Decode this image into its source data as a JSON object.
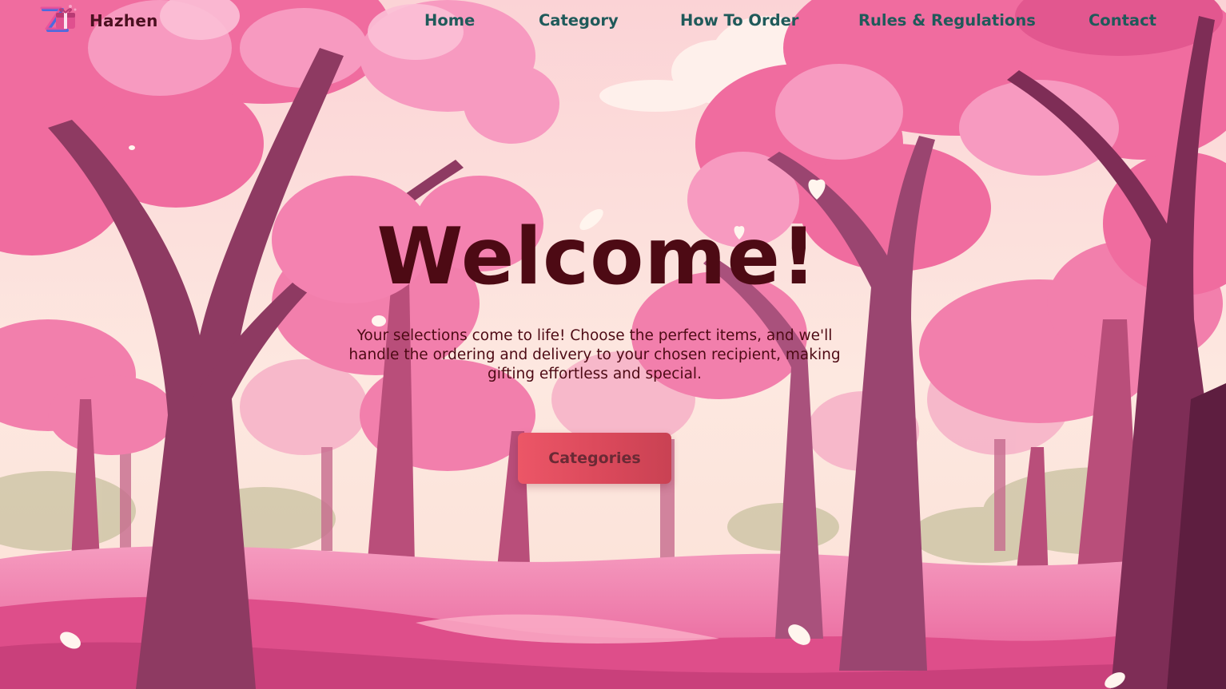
{
  "brand": {
    "name": "Hazhen",
    "logo_icon": "gift-z-logo-icon"
  },
  "nav": {
    "items": [
      {
        "label": "Home"
      },
      {
        "label": "Category"
      },
      {
        "label": "How To Order"
      },
      {
        "label": "Rules & Regulations"
      },
      {
        "label": "Contact"
      }
    ]
  },
  "hero": {
    "title": "Welcome!",
    "subtitle": "Your selections come to life! Choose the perfect items, and we'll handle the ordering and delivery to your chosen recipient, making gifting effortless and special.",
    "cta_label": "Categories",
    "background": "pink-cherry-blossom-forest-illustration"
  },
  "colors": {
    "nav_text": "#1f5a5a",
    "title_text": "#4d0a14",
    "cta_bg": "#e24f61",
    "cta_text": "#6a2a35",
    "blossom_pink": "#f279a6",
    "trunk": "#8d3a5e"
  }
}
